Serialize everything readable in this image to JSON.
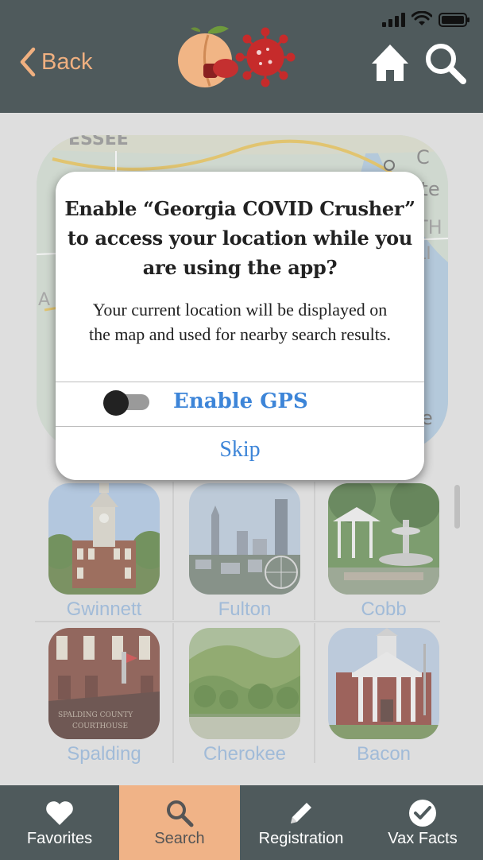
{
  "header": {
    "back_label": "Back",
    "logo_name": "peach-vs-virus-logo",
    "home_icon": "home-icon",
    "search_icon": "search-icon"
  },
  "status_bar": {
    "icons": [
      "cellular-signal-icon",
      "wifi-icon",
      "battery-icon"
    ]
  },
  "map": {
    "labels": [
      "ESSEE",
      "C",
      "tte",
      "TH",
      "LI",
      "A",
      "e"
    ]
  },
  "dialog": {
    "title": "Enable “Georgia COVID Crusher” to access your location while you are using the app?",
    "message": "Your current location will be displayed on the map and used for nearby search results.",
    "gps_label": "Enable GPS",
    "gps_enabled": false,
    "skip_label": "Skip"
  },
  "counties": [
    {
      "name": "Gwinnett",
      "icon": "courthouse-photo"
    },
    {
      "name": "Fulton",
      "icon": "city-skyline-photo"
    },
    {
      "name": "Cobb",
      "icon": "fountain-park-photo"
    },
    {
      "name": "Spalding",
      "icon": "brick-courthouse-photo"
    },
    {
      "name": "Cherokee",
      "icon": "forest-lake-photo"
    },
    {
      "name": "Bacon",
      "icon": "white-courthouse-photo"
    }
  ],
  "tabs": [
    {
      "label": "Favorites",
      "icon": "heart-icon",
      "active": false
    },
    {
      "label": "Search",
      "icon": "search-icon",
      "active": true
    },
    {
      "label": "Registration",
      "icon": "pencil-icon",
      "active": false
    },
    {
      "label": "Vax Facts",
      "icon": "checkmark-circle-icon",
      "active": false
    }
  ],
  "colors": {
    "header_bg": "#4f5a5c",
    "accent_peach": "#f0b387",
    "link_blue": "#3d85d8",
    "county_label": "#8fb3db"
  }
}
